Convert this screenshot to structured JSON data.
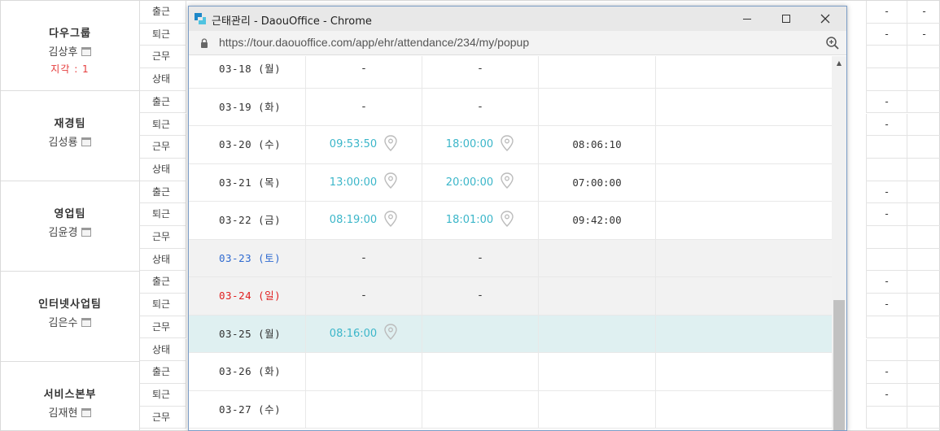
{
  "teams": [
    {
      "name": "다우그룹",
      "member": "김상후",
      "late": "지각 : 1"
    },
    {
      "name": "재경팀",
      "member": "김성룡"
    },
    {
      "name": "영업팀",
      "member": "김윤경"
    },
    {
      "name": "인터넷사업팀",
      "member": "김은수"
    },
    {
      "name": "서비스본부",
      "member": "김재현"
    }
  ],
  "row_labels": [
    "출근",
    "퇴근",
    "근무",
    "상태"
  ],
  "bg_dash": "-",
  "popup": {
    "title": "근태관리 - DaouOffice - Chrome",
    "url": "https://tour.daouoffice.com/app/ehr/attendance/234/my/popup",
    "rows": [
      {
        "date": "03-18 (월)",
        "in": "-",
        "out": "-",
        "work": ""
      },
      {
        "date": "03-19 (화)",
        "in": "-",
        "out": "-",
        "work": ""
      },
      {
        "date": "03-20 (수)",
        "in": "09:53:50",
        "out": "18:00:00",
        "work": "08:06:10"
      },
      {
        "date": "03-21 (목)",
        "in": "13:00:00",
        "out": "20:00:00",
        "work": "07:00:00"
      },
      {
        "date": "03-22 (금)",
        "in": "08:19:00",
        "out": "18:01:00",
        "work": "09:42:00"
      },
      {
        "date": "03-23 (토)",
        "in": "-",
        "out": "-",
        "work": ""
      },
      {
        "date": "03-24 (일)",
        "in": "-",
        "out": "-",
        "work": ""
      },
      {
        "date": "03-25 (월)",
        "in": "08:16:00",
        "out": "",
        "work": ""
      },
      {
        "date": "03-26 (화)",
        "in": "",
        "out": "",
        "work": ""
      },
      {
        "date": "03-27 (수)",
        "in": "",
        "out": "",
        "work": ""
      }
    ]
  },
  "colors": {
    "accent": "#3bb6c9",
    "saturday": "#2f6ad0",
    "sunday": "#e02020",
    "late": "#e53b3b"
  }
}
